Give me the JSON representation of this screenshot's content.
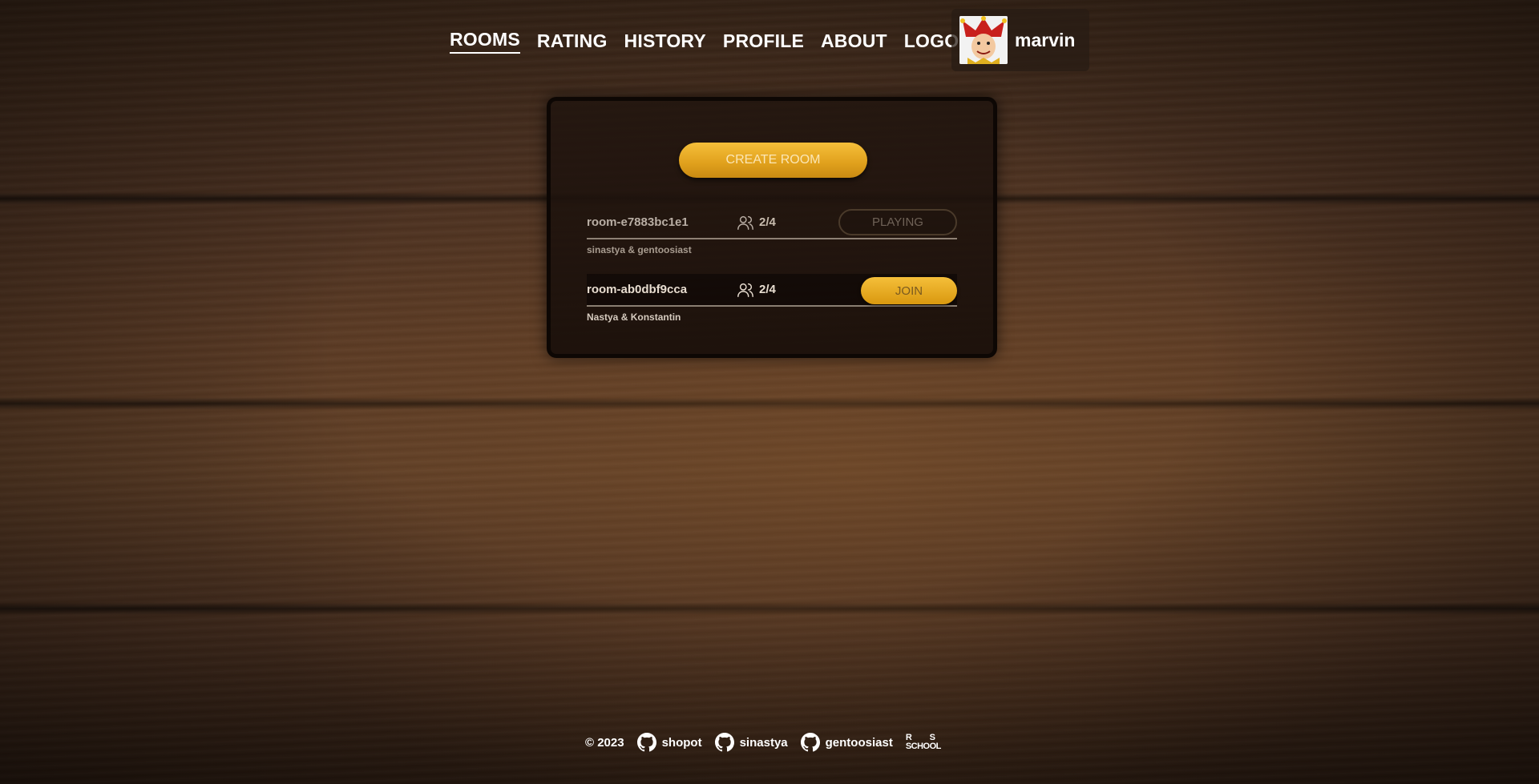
{
  "nav": {
    "items": [
      {
        "label": "ROOMS",
        "active": true
      },
      {
        "label": "RATING",
        "active": false
      },
      {
        "label": "HISTORY",
        "active": false
      },
      {
        "label": "PROFILE",
        "active": false
      },
      {
        "label": "ABOUT",
        "active": false
      },
      {
        "label": "LOGOUT",
        "active": false
      }
    ],
    "user": {
      "name": "marvin",
      "avatar_icon": "jester-avatar-icon"
    }
  },
  "panel": {
    "create_label": "CREATE ROOM",
    "rooms": [
      {
        "name": "room-e7883bc1e1",
        "players": "2/4",
        "players_icon": "users-icon",
        "action": "PLAYING",
        "members": "sinastya & gentoosiast"
      },
      {
        "name": "room-ab0dbf9cca",
        "players": "2/4",
        "players_icon": "users-icon",
        "action": "JOIN",
        "members": "Nastya & Konstantin"
      }
    ]
  },
  "footer": {
    "copyright": "© 2023",
    "links": [
      {
        "label": "shopot",
        "icon": "github-icon"
      },
      {
        "label": "sinastya",
        "icon": "github-icon"
      },
      {
        "label": "gentoosiast",
        "icon": "github-icon"
      }
    ],
    "school_logo": "RS SCHOOL"
  },
  "colors": {
    "accent": "#e8a81f",
    "panel_border": "#0d0704",
    "text": "#ffffff"
  }
}
